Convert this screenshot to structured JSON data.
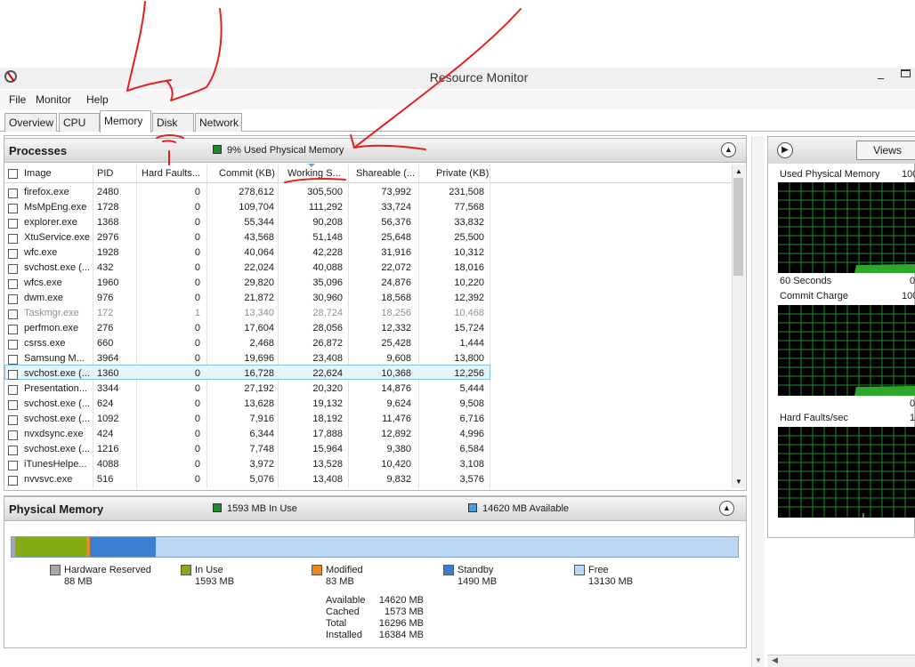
{
  "window": {
    "title": "Resource Monitor"
  },
  "menu": {
    "items": [
      "File",
      "Monitor",
      "Help"
    ]
  },
  "tabs": [
    {
      "label": "Overview",
      "active": false
    },
    {
      "label": "CPU",
      "active": false
    },
    {
      "label": "Memory",
      "active": true
    },
    {
      "label": "Disk",
      "active": false
    },
    {
      "label": "Network",
      "active": false
    }
  ],
  "processes": {
    "title": "Processes",
    "summary": "9% Used Physical Memory",
    "columns": [
      "Image",
      "PID",
      "Hard Faults...",
      "Commit (KB)",
      "Working S...",
      "Shareable (...",
      "Private (KB)"
    ],
    "rows": [
      [
        "firefox.exe",
        "2480",
        "0",
        "278,612",
        "305,500",
        "73,992",
        "231,508"
      ],
      [
        "MsMpEng.exe",
        "1728",
        "0",
        "109,704",
        "111,292",
        "33,724",
        "77,568"
      ],
      [
        "explorer.exe",
        "1368",
        "0",
        "55,344",
        "90,208",
        "56,376",
        "33,832"
      ],
      [
        "XtuService.exe",
        "2976",
        "0",
        "43,568",
        "51,148",
        "25,648",
        "25,500"
      ],
      [
        "wfc.exe",
        "1928",
        "0",
        "40,064",
        "42,228",
        "31,916",
        "10,312"
      ],
      [
        "svchost.exe (...",
        "432",
        "0",
        "22,024",
        "40,088",
        "22,072",
        "18,016"
      ],
      [
        "wfcs.exe",
        "1960",
        "0",
        "29,820",
        "35,096",
        "24,876",
        "10,220"
      ],
      [
        "dwm.exe",
        "976",
        "0",
        "21,872",
        "30,960",
        "18,568",
        "12,392"
      ],
      [
        "Taskmgr.exe",
        "172",
        "1",
        "13,340",
        "28,724",
        "18,256",
        "10,468"
      ],
      [
        "perfmon.exe",
        "276",
        "0",
        "17,604",
        "28,056",
        "12,332",
        "15,724"
      ],
      [
        "csrss.exe",
        "660",
        "0",
        "2,468",
        "26,872",
        "25,428",
        "1,444"
      ],
      [
        "Samsung M...",
        "3964",
        "0",
        "19,696",
        "23,408",
        "9,608",
        "13,800"
      ],
      [
        "svchost.exe (...",
        "1360",
        "0",
        "16,728",
        "22,624",
        "10,368",
        "12,256"
      ],
      [
        "Presentation...",
        "3344",
        "0",
        "27,192",
        "20,320",
        "14,876",
        "5,444"
      ],
      [
        "svchost.exe (...",
        "624",
        "0",
        "13,628",
        "19,132",
        "9,624",
        "9,508"
      ],
      [
        "svchost.exe (...",
        "1092",
        "0",
        "7,916",
        "18,192",
        "11,476",
        "6,716"
      ],
      [
        "nvxdsync.exe",
        "424",
        "0",
        "6,344",
        "17,888",
        "12,892",
        "4,996"
      ],
      [
        "svchost.exe (...",
        "1216",
        "0",
        "7,748",
        "15,964",
        "9,380",
        "6,584"
      ],
      [
        "iTunesHelpe...",
        "4088",
        "0",
        "3,972",
        "13,528",
        "10,420",
        "3,108"
      ],
      [
        "nvvsvc.exe",
        "516",
        "0",
        "5,076",
        "13,408",
        "9,832",
        "3,576"
      ]
    ]
  },
  "physical_memory": {
    "title": "Physical Memory",
    "in_use_summary": "1593 MB In Use",
    "available_summary": "14620 MB Available",
    "bar": {
      "reserved_mb": 88,
      "in_use_mb": 1593,
      "modified_mb": 83,
      "standby_mb": 1490,
      "free_mb": 13130
    },
    "legend": [
      {
        "label": "Hardware Reserved",
        "value": "88 MB",
        "color": "#a8a8a8"
      },
      {
        "label": "In Use",
        "value": "1593 MB",
        "color": "#82ab16"
      },
      {
        "label": "Modified",
        "value": "83 MB",
        "color": "#e8891c"
      },
      {
        "label": "Standby",
        "value": "1490 MB",
        "color": "#3a7fd0"
      },
      {
        "label": "Free",
        "value": "13130 MB",
        "color": "#bcd7f5"
      }
    ],
    "stats": [
      {
        "label": "Available",
        "value": "14620 MB"
      },
      {
        "label": "Cached",
        "value": "1573 MB"
      },
      {
        "label": "Total",
        "value": "16296 MB"
      },
      {
        "label": "Installed",
        "value": "16384 MB"
      }
    ]
  },
  "right_pane": {
    "views_label": "Views",
    "graphs": [
      {
        "label": "Used Physical Memory",
        "right": "100"
      },
      {
        "label": "Commit Charge",
        "right": "100"
      },
      {
        "label": "Hard Faults/sec",
        "right": "1"
      }
    ],
    "seconds_label": "60 Seconds",
    "seconds_right": "0",
    "commit_bottom_right": "0"
  }
}
